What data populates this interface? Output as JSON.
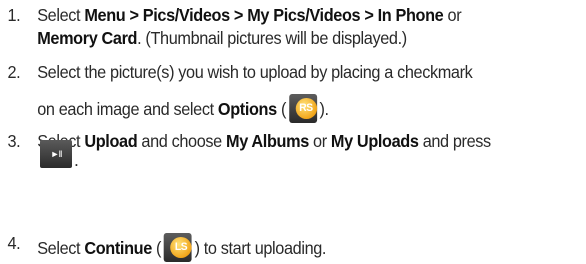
{
  "steps": [
    {
      "number": "1.",
      "line1_a": "Select ",
      "line1_b": "Menu > Pics/Videos > My Pics/Videos > In Phone",
      "line1_c": " or",
      "line2_a": "Memory Card",
      "line2_b": ". (Thumbnail pictures will be displayed.)"
    },
    {
      "number": "2.",
      "line1_a": "Select the picture(s) you wish to upload by placing a checkmark",
      "line2_a": "on each image and select ",
      "line2_b": "Options",
      "line2_c": " (",
      "icon_label": "RS",
      "line2_d": ")."
    },
    {
      "number": "3.",
      "line1_a": "Select ",
      "line1_b": "Upload",
      "line1_c": " and choose ",
      "line1_d": "My Albums",
      "line1_e": " or ",
      "line1_f": "My Uploads",
      "line1_g": " and press",
      "key_label": "►II",
      "line2_a": "."
    },
    {
      "number": "4.",
      "line1_a": "Select ",
      "line1_b": "Continue",
      "line1_c": " (",
      "icon_label": "LS",
      "line1_d": ") to start uploading."
    }
  ],
  "colors": {
    "text": "#2a2a2a",
    "softkey_gold": "#f1a51a",
    "button_dark": "#2a2a2a"
  }
}
